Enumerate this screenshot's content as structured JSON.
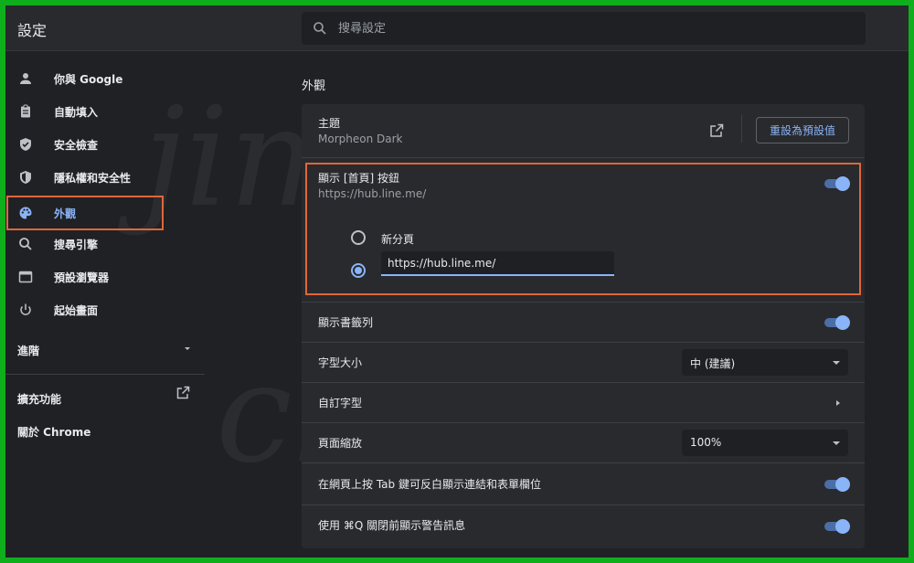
{
  "header": {
    "title": "設定",
    "search_placeholder": "搜尋設定"
  },
  "sidebar": {
    "items": [
      {
        "label": "你與 Google",
        "icon": "person-icon"
      },
      {
        "label": "自動填入",
        "icon": "clipboard-icon"
      },
      {
        "label": "安全檢查",
        "icon": "shield-check-icon"
      },
      {
        "label": "隱私權和安全性",
        "icon": "shield-icon"
      },
      {
        "label": "外觀",
        "icon": "palette-icon"
      },
      {
        "label": "搜尋引擎",
        "icon": "search-icon"
      },
      {
        "label": "預設瀏覽器",
        "icon": "browser-icon"
      },
      {
        "label": "起始畫面",
        "icon": "power-icon"
      }
    ],
    "advanced": "進階",
    "extensions": "擴充功能",
    "about": "關於 Chrome"
  },
  "main": {
    "section_title": "外觀",
    "theme": {
      "label": "主題",
      "value": "Morpheon Dark",
      "reset_label": "重設為預設值"
    },
    "home_button": {
      "label": "顯示 [首頁] 按鈕",
      "url": "https://hub.line.me/",
      "option_new_tab": "新分頁",
      "custom_url_value": "https://hub.line.me/",
      "enabled": true
    },
    "bookmarks_bar": {
      "label": "顯示書籤列",
      "enabled": true
    },
    "font_size": {
      "label": "字型大小",
      "value": "中 (建議)"
    },
    "custom_fonts": {
      "label": "自訂字型"
    },
    "page_zoom": {
      "label": "頁面縮放",
      "value": "100%"
    },
    "tab_highlight": {
      "label": "在網頁上按 Tab 鍵可反白顯示連結和表單欄位",
      "enabled": true
    },
    "quit_warning": {
      "label": "使用 ⌘Q 關閉前顯示警告訊息",
      "enabled": true
    }
  },
  "colors": {
    "accent": "#8ab4f8",
    "highlight": "#e0663a",
    "frame": "#0fae1d",
    "background": "#202124",
    "card": "#292a2d"
  }
}
